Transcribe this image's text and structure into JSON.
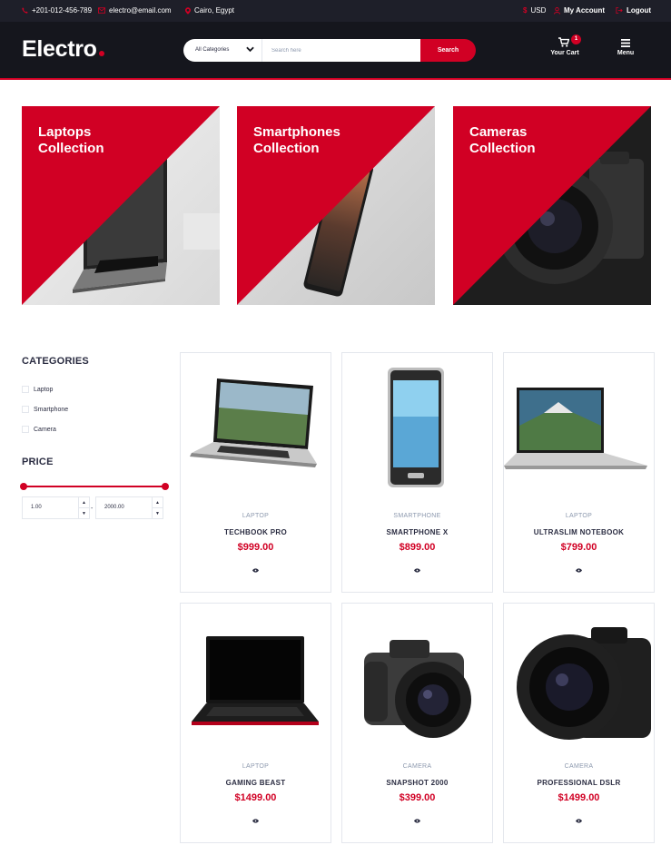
{
  "topbar": {
    "phone": "+201-012-456-789",
    "email": "electro@email.com",
    "location": "Cairo, Egypt",
    "currency": "USD",
    "account": "My Account",
    "logout": "Logout"
  },
  "header": {
    "logo": "Electro",
    "search_category": "All Categories",
    "search_placeholder": "Search here",
    "search_button": "Search",
    "cart_label": "Your Cart",
    "cart_count": "1",
    "menu_label": "Menu"
  },
  "collections": [
    {
      "line1": "Laptops",
      "line2": "Collection"
    },
    {
      "line1": "Smartphones",
      "line2": "Collection"
    },
    {
      "line1": "Cameras",
      "line2": "Collection"
    }
  ],
  "sidebar": {
    "categories_title": "CATEGORIES",
    "categories": [
      "Laptop",
      "Smartphone",
      "Camera"
    ],
    "price_title": "PRICE",
    "price_min": "1.00",
    "price_max": "2000.00",
    "price_separator": "-",
    "stepper_up": "▲",
    "stepper_down": "▼"
  },
  "products": [
    {
      "category": "LAPTOP",
      "name": "TECHBOOK PRO",
      "price": "$999.00"
    },
    {
      "category": "SMARTPHONE",
      "name": "SMARTPHONE X",
      "price": "$899.00"
    },
    {
      "category": "LAPTOP",
      "name": "ULTRASLIM NOTEBOOK",
      "price": "$799.00"
    },
    {
      "category": "LAPTOP",
      "name": "GAMING BEAST",
      "price": "$1499.00"
    },
    {
      "category": "CAMERA",
      "name": "SNAPSHOT 2000",
      "price": "$399.00"
    },
    {
      "category": "CAMERA",
      "name": "PROFESSIONAL DSLR",
      "price": "$1499.00"
    }
  ],
  "colors": {
    "accent": "#D10024",
    "header_bg": "#15161D",
    "topbar_bg": "#1E1F29",
    "text": "#2B2D42",
    "muted": "#8D99AE",
    "border": "#E4E7ED"
  },
  "icons": [
    "phone-icon",
    "envelope-icon",
    "map-marker-icon",
    "dollar-icon",
    "user-icon",
    "logout-icon",
    "chevron-down-icon",
    "cart-icon",
    "menu-icon",
    "eye-icon"
  ]
}
